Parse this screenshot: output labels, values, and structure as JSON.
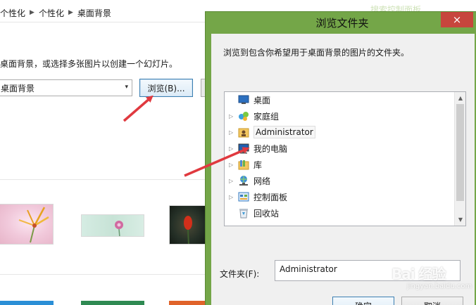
{
  "background": {
    "breadcrumb": [
      "个性化",
      "个性化",
      "桌面背景"
    ],
    "instruction": "桌面背景，或选择多张图片以创建一个幻灯片。",
    "location_select": {
      "value": "桌面背景"
    },
    "browse_button": "浏览(B)...",
    "partial_title": "搜索控制面板"
  },
  "dialog": {
    "title": "浏览文件夹",
    "close_icon": "×",
    "description": "浏览到包含你希望用于桌面背景的图片的文件夹。",
    "tree": [
      {
        "label": "桌面",
        "icon": "desktop-icon",
        "expand": ""
      },
      {
        "label": "家庭组",
        "icon": "homegroup-icon",
        "expand": "▷"
      },
      {
        "label": "Administrator",
        "icon": "user-folder-icon",
        "expand": "▷",
        "selected": true
      },
      {
        "label": "我的电脑",
        "icon": "computer-icon",
        "expand": "▷"
      },
      {
        "label": "库",
        "icon": "library-icon",
        "expand": "▷"
      },
      {
        "label": "网络",
        "icon": "network-icon",
        "expand": "▷"
      },
      {
        "label": "控制面板",
        "icon": "control-panel-icon",
        "expand": "▷"
      },
      {
        "label": "回收站",
        "icon": "recycle-bin-icon",
        "expand": ""
      }
    ],
    "folder_label": "文件夹(F):",
    "folder_value": "Administrator",
    "ok_button": "确定",
    "cancel_button": "取消"
  },
  "watermark": {
    "main": "Bai 经验",
    "sub": "jingyan.baidu.com"
  },
  "colors": {
    "dialog_frame": "#74a648",
    "close_button": "#c7463d",
    "annotation_arrow": "#e0393f",
    "button_border": "#3c7fb1"
  }
}
